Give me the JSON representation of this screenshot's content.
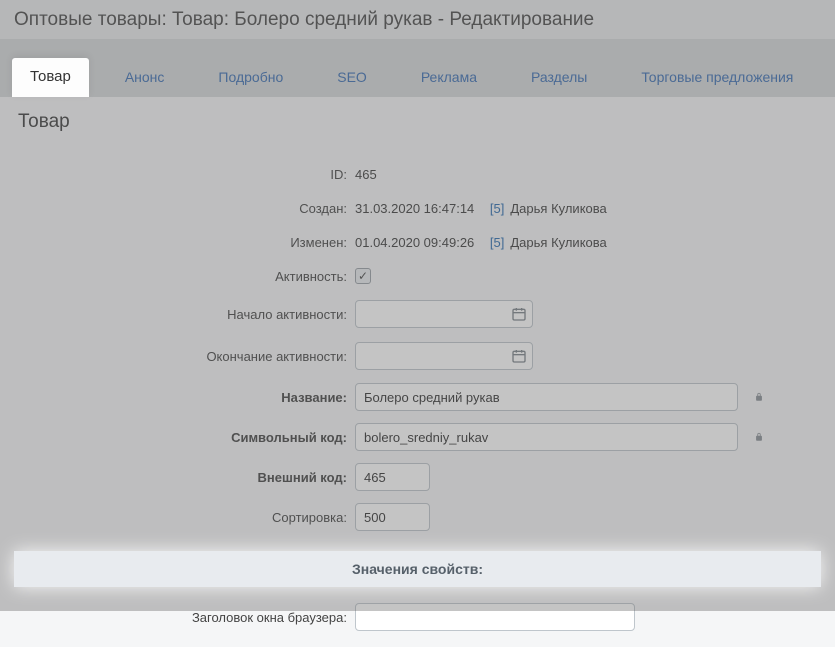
{
  "title": "Оптовые товары: Товар: Болеро средний рукав - Редактирование",
  "tabs": [
    {
      "label": "Товар"
    },
    {
      "label": "Анонс"
    },
    {
      "label": "Подробно"
    },
    {
      "label": "SEO"
    },
    {
      "label": "Реклама"
    },
    {
      "label": "Разделы"
    },
    {
      "label": "Торговые предложения"
    }
  ],
  "panel_heading": "Товар",
  "labels": {
    "id": "ID:",
    "created": "Создан:",
    "modified": "Изменен:",
    "activity": "Активность:",
    "active_from": "Начало активности:",
    "active_to": "Окончание активности:",
    "name": "Название:",
    "code": "Символьный код:",
    "external": "Внешний код:",
    "sort": "Сортировка:",
    "browser_title": "Заголовок окна браузера:"
  },
  "fields": {
    "id": "465",
    "created_date": "31.03.2020 16:47:14",
    "modified_date": "01.04.2020 09:49:26",
    "author_id": "[5]",
    "author_name": "Дарья Куликова",
    "activity_checked": "✓",
    "active_from": "",
    "active_to": "",
    "name": "Болеро средний рукав",
    "code": "bolero_sredniy_rukav",
    "external": "465",
    "sort": "500",
    "browser_title": ""
  },
  "section_header": "Значения свойств:"
}
